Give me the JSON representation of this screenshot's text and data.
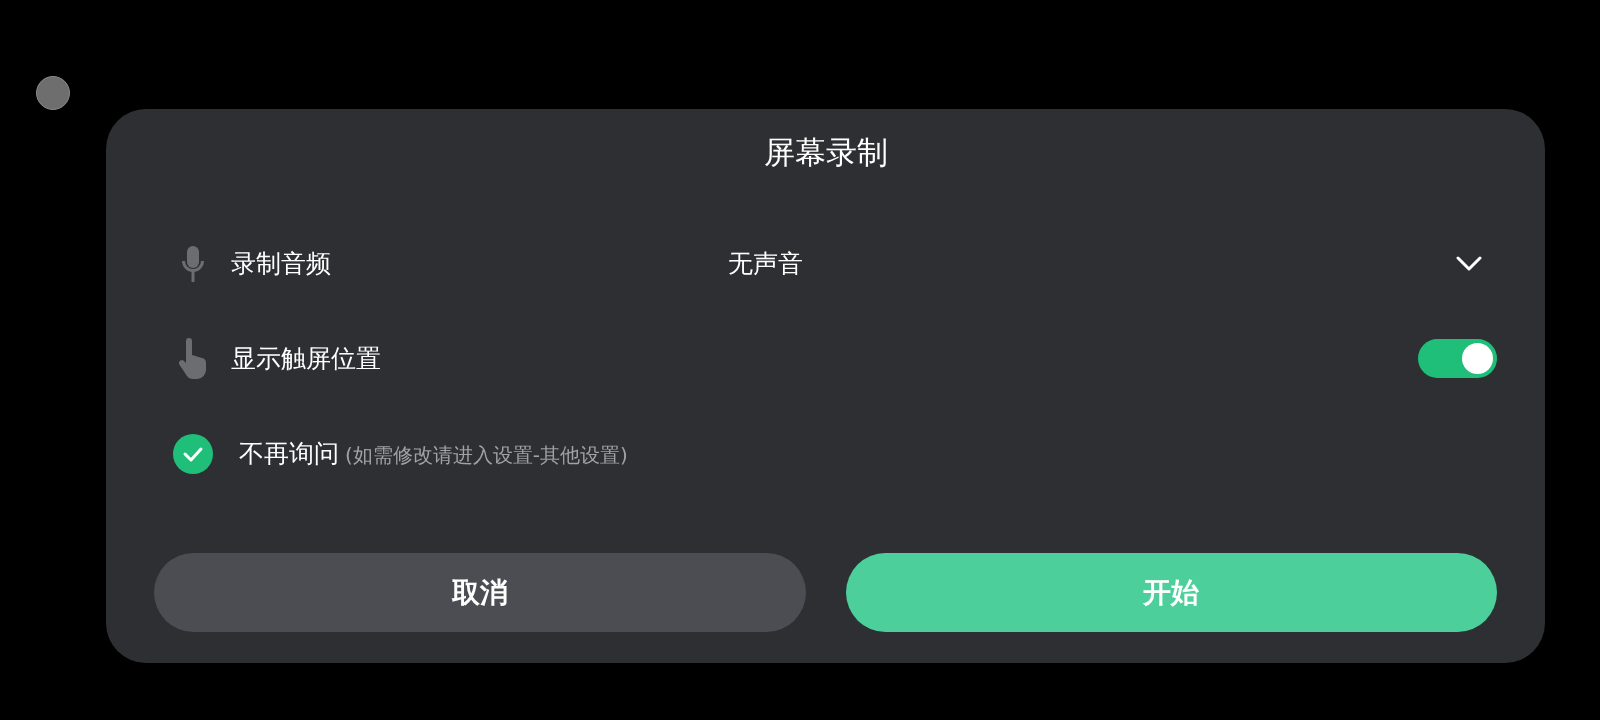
{
  "title": "屏幕录制",
  "settings": [
    {
      "kind": "dropdown",
      "label": "录制音频",
      "value": "无声音"
    },
    {
      "kind": "toggle",
      "label": "显示触屏位置",
      "on": true
    }
  ],
  "dont_ask": {
    "checked": true,
    "label": "不再询问",
    "hint": "(如需修改请进入设置-其他设置)"
  },
  "buttons": [
    {
      "kind": "secondary",
      "label": "取消"
    },
    {
      "kind": "primary",
      "label": "开始"
    }
  ]
}
